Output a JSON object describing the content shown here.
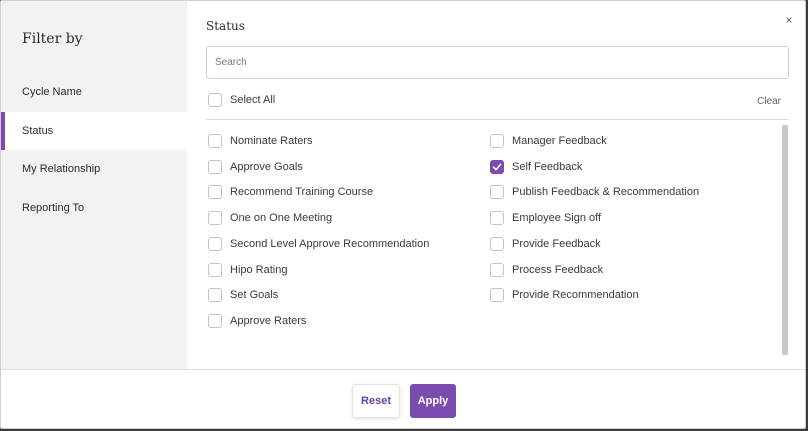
{
  "sidebar": {
    "title": "Filter by",
    "items": [
      {
        "label": "Cycle Name"
      },
      {
        "label": "Status"
      },
      {
        "label": "My Relationship"
      },
      {
        "label": "Reporting To"
      }
    ],
    "active_item": "Status"
  },
  "panel": {
    "title": "Status",
    "close_label": "×",
    "search": {
      "placeholder": "Search",
      "value": ""
    },
    "select_all_label": "Select All",
    "clear_label": "Clear",
    "options_left": [
      {
        "label": "Nominate Raters",
        "checked": false
      },
      {
        "label": "Approve Goals",
        "checked": false
      },
      {
        "label": "Recommend Training Course",
        "checked": false
      },
      {
        "label": "One on One Meeting",
        "checked": false
      },
      {
        "label": "Second Level Approve Recommendation",
        "checked": false
      },
      {
        "label": "Hipo Rating",
        "checked": false
      },
      {
        "label": "Set Goals",
        "checked": false
      },
      {
        "label": "Approve Raters",
        "checked": false
      }
    ],
    "options_right": [
      {
        "label": "Manager Feedback",
        "checked": false
      },
      {
        "label": "Self Feedback",
        "checked": true
      },
      {
        "label": "Publish Feedback & Recommendation",
        "checked": false
      },
      {
        "label": "Employee Sign off",
        "checked": false
      },
      {
        "label": "Provide Feedback",
        "checked": false
      },
      {
        "label": "Process Feedback",
        "checked": false
      },
      {
        "label": "Provide Recommendation",
        "checked": false
      }
    ]
  },
  "footer": {
    "reset_label": "Reset",
    "apply_label": "Apply"
  },
  "colors": {
    "accent": "#7b4bb0",
    "sidebar_bg": "#f2f2f2"
  }
}
